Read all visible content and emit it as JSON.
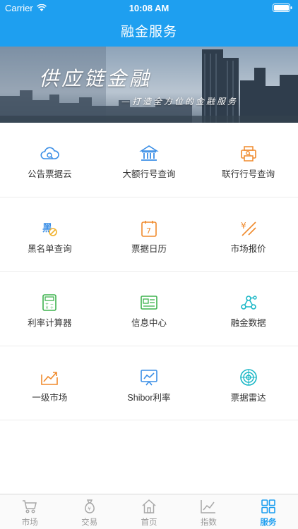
{
  "status_bar": {
    "carrier": "Carrier",
    "time": "10:08 AM"
  },
  "header": {
    "title": "融金服务"
  },
  "banner": {
    "title": "供应链金融",
    "subtitle": "—打造全方位的金融服务"
  },
  "services": [
    [
      {
        "label": "公告票据云",
        "icon": "cloud-search-icon"
      },
      {
        "label": "大额行号查询",
        "icon": "bank-icon"
      },
      {
        "label": "联行行号查询",
        "icon": "printer-search-icon"
      }
    ],
    [
      {
        "label": "黑名单查询",
        "icon": "blacklist-icon"
      },
      {
        "label": "票据日历",
        "icon": "calendar-icon"
      },
      {
        "label": "市场报价",
        "icon": "yen-price-icon"
      }
    ],
    [
      {
        "label": "利率计算器",
        "icon": "calculator-icon"
      },
      {
        "label": "信息中心",
        "icon": "news-icon"
      },
      {
        "label": "融金数据",
        "icon": "network-data-icon"
      }
    ],
    [
      {
        "label": "一级市场",
        "icon": "primary-market-icon"
      },
      {
        "label": "Shibor利率",
        "icon": "trend-board-icon"
      },
      {
        "label": "票据雷达",
        "icon": "radar-icon"
      }
    ]
  ],
  "tabbar": [
    {
      "label": "市场",
      "icon": "cart-icon",
      "active": false
    },
    {
      "label": "交易",
      "icon": "money-bag-icon",
      "active": false
    },
    {
      "label": "首页",
      "icon": "home-icon",
      "active": false
    },
    {
      "label": "指数",
      "icon": "index-chart-icon",
      "active": false
    },
    {
      "label": "服务",
      "icon": "grid-icon",
      "active": true
    }
  ],
  "colors": {
    "header": "#1e9ff0",
    "active_tab": "#1e9ff0",
    "icon_blue": "#3a8ee6",
    "icon_orange": "#f08a2c",
    "icon_green": "#3fb34f",
    "icon_cyan": "#19b7c6"
  }
}
